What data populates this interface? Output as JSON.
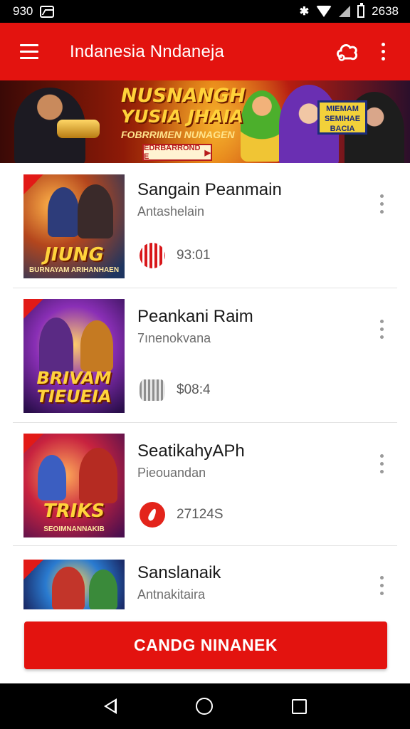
{
  "status_bar": {
    "left_text": "930",
    "time": "2638"
  },
  "app_bar": {
    "title": "Indanesia Nndaneja"
  },
  "banner": {
    "title_line1": "NUSNANGH",
    "title_line2": "YUSIA JHAIA",
    "subtitle": "FOBRRIMEN NUNAGEN",
    "cta_label": "EDRBARROND E",
    "sign_text": "MIEMAM SEMIHAE BACIA"
  },
  "list": {
    "items": [
      {
        "title": "Sangain Peanmain",
        "subtitle": "Antashelain",
        "stat": "93:01",
        "stat_icon": "rating-icon",
        "thumb_text": "JIUNG",
        "thumb_sub": "BURNAYAM ARIHANHAEN"
      },
      {
        "title": "Peankani Raim",
        "subtitle": "7ınenokvana",
        "stat": "$08:4",
        "stat_icon": "coin-icon",
        "thumb_text": "BRIVAM TIEUEIA",
        "thumb_sub": ""
      },
      {
        "title": "SeatikahyAPh",
        "subtitle": "Pieouandan",
        "stat": "27124S",
        "stat_icon": "fire-icon",
        "thumb_text": "TRIKS",
        "thumb_sub": "SEOIMNANNAKIB"
      },
      {
        "title": "Sanslanaik",
        "subtitle": "Antnakitaira",
        "stat": "",
        "stat_icon": "",
        "thumb_text": "",
        "thumb_sub": ""
      }
    ]
  },
  "cta_button": {
    "label": "CANDG NINANEK"
  },
  "colors": {
    "brand_red": "#e3130f",
    "divider": "#e3e3e3",
    "text_primary": "#1a1a1a",
    "text_secondary": "#6d6d6d"
  }
}
